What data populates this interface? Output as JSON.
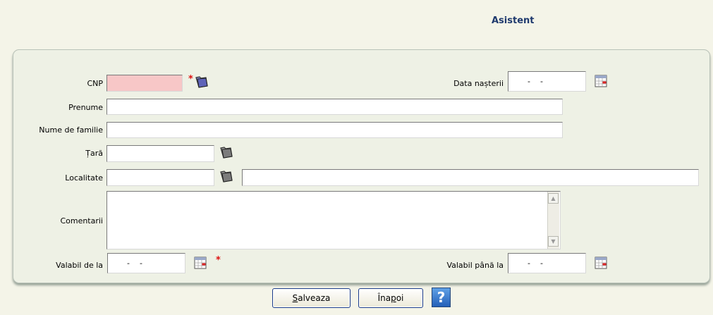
{
  "header": {
    "title": "Asistent"
  },
  "form": {
    "cnp": {
      "label": "CNP",
      "value": ""
    },
    "birth_date": {
      "label": "Data nașterii",
      "value": "  -    -  "
    },
    "first_name": {
      "label": "Prenume",
      "value": ""
    },
    "last_name": {
      "label": "Nume de familie",
      "value": ""
    },
    "country": {
      "label": "Țară",
      "value": ""
    },
    "locality": {
      "label": "Localitate",
      "code": "",
      "name": ""
    },
    "comments": {
      "label": "Comentarii",
      "value": ""
    },
    "valid_from": {
      "label": "Valabil de la",
      "value": "  -    -  "
    },
    "valid_until": {
      "label": "Valabil până la",
      "value": "  -    -  "
    },
    "required_mark": "*"
  },
  "buttons": {
    "save": {
      "accel": "S",
      "rest": "alveaza"
    },
    "back": {
      "before": "Îna",
      "accel": "p",
      "rest": "oi"
    },
    "help": "?"
  },
  "colors": {
    "title": "#1f3a6e",
    "required_field": "#f7c7c7",
    "required_mark": "#dd1111",
    "panel": "#eef1e5",
    "background": "#f4f4e8"
  },
  "icons": {
    "cnp_lookup": "folder-icon",
    "country_lookup": "folder-icon",
    "locality_lookup": "folder-icon",
    "date_picker": "calendar-icon"
  }
}
